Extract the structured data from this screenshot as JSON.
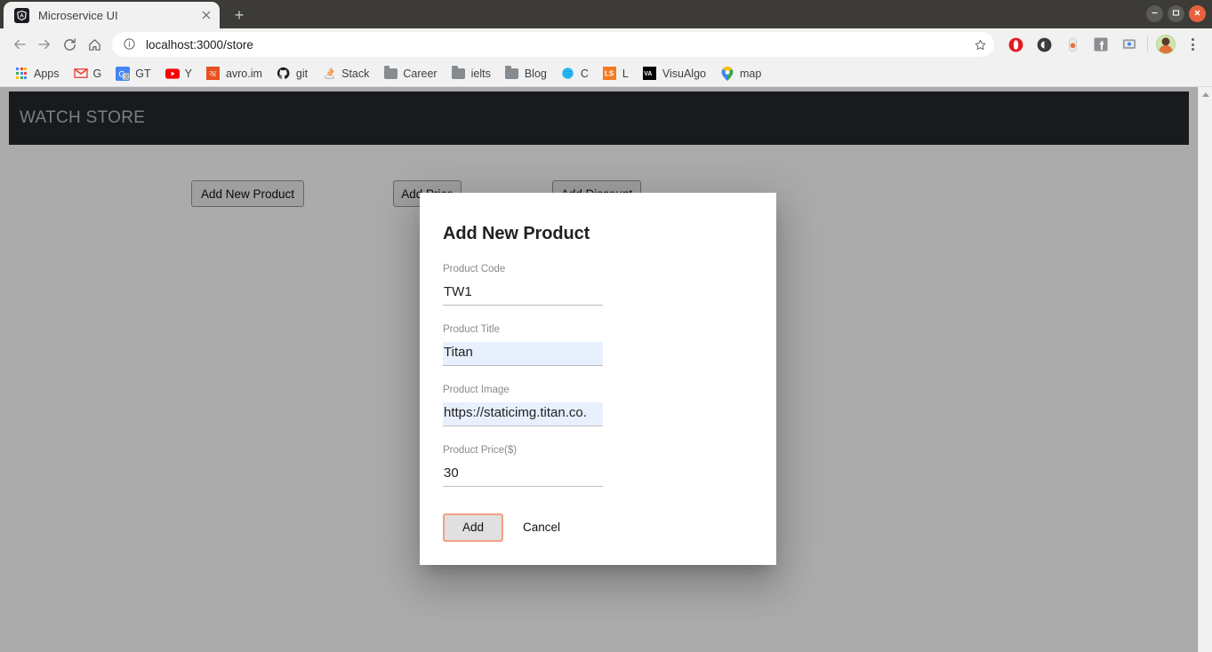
{
  "browser": {
    "tab": {
      "title": "Microservice UI",
      "favicon_icon": "angular-logo-icon",
      "close_icon": "close-icon"
    },
    "newtab_label": "+",
    "window_controls": {
      "minimize": "—",
      "maximize": "□",
      "close": "✕"
    },
    "nav": {
      "back_icon": "arrow-left-icon",
      "forward_icon": "arrow-right-icon",
      "reload_icon": "reload-icon",
      "home_icon": "home-icon"
    },
    "omnibox": {
      "info_icon": "info-circle-icon",
      "url": "localhost:3000/store",
      "star_icon": "star-icon"
    },
    "extensions": [
      {
        "name": "opera-extension-icon",
        "color": "#e11b22"
      },
      {
        "name": "dark-circle-extension-icon",
        "color": "#3a3a3a"
      },
      {
        "name": "orange-pill-extension-icon",
        "color": "#e8703a"
      },
      {
        "name": "facebook-extension-icon",
        "color": "#8a8d91"
      },
      {
        "name": "cast-extension-icon",
        "color": "#8a8d91"
      }
    ],
    "avatar_name": "user-avatar",
    "menu_icon": "three-dot-menu-icon",
    "bookmarks": [
      {
        "label": "Apps",
        "icon": "apps-grid-icon"
      },
      {
        "label": "G",
        "icon": "gmail-icon"
      },
      {
        "label": "GT",
        "icon": "google-translate-icon"
      },
      {
        "label": "Y",
        "icon": "youtube-icon"
      },
      {
        "label": "avro.im",
        "icon": "avro-icon"
      },
      {
        "label": "git",
        "icon": "github-icon"
      },
      {
        "label": "Stack",
        "icon": "stackoverflow-icon"
      },
      {
        "label": "Career",
        "icon": "folder-icon"
      },
      {
        "label": "ielts",
        "icon": "folder-icon"
      },
      {
        "label": "Blog",
        "icon": "folder-icon"
      },
      {
        "label": "C",
        "icon": "blue-circle-icon"
      },
      {
        "label": "L",
        "icon": "ls-orange-icon"
      },
      {
        "label": "VisuAlgo",
        "icon": "visualgo-icon"
      },
      {
        "label": "map",
        "icon": "map-pin-icon"
      }
    ]
  },
  "app": {
    "header_title": "WATCH STORE",
    "header_bg": "#24282e",
    "buttons": [
      {
        "label": "Add New Product"
      },
      {
        "label": "Add Price"
      },
      {
        "label": "Add Discount"
      }
    ]
  },
  "modal": {
    "title": "Add New Product",
    "fields": [
      {
        "label": "Product Code",
        "value": "TW1",
        "autofill": false
      },
      {
        "label": "Product Title",
        "value": "Titan",
        "autofill": true
      },
      {
        "label": "Product Image",
        "value": "https://staticimg.titan.co.",
        "autofill": true
      },
      {
        "label": "Product Price($)",
        "value": "30",
        "autofill": false
      }
    ],
    "add_label": "Add",
    "cancel_label": "Cancel",
    "add_focus_color": "#f2a184"
  },
  "scrollbar": {
    "up_arrow_icon": "scroll-up-arrow-icon"
  }
}
